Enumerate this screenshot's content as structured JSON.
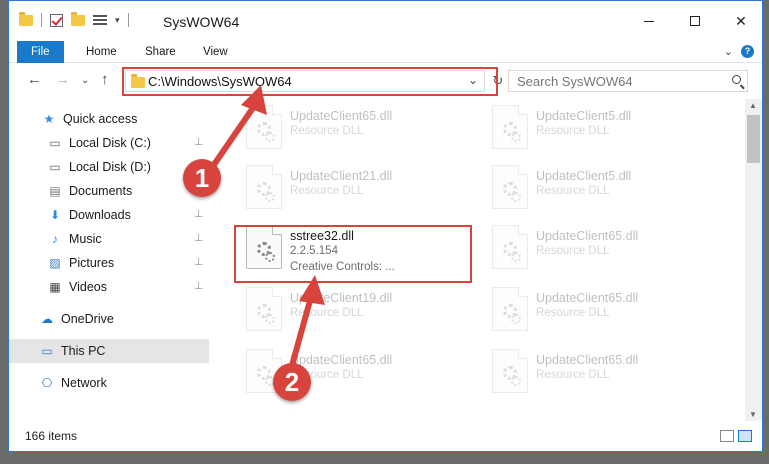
{
  "window": {
    "title": "SysWOW64",
    "controls": {
      "minimize": "—",
      "maximize": "☐",
      "close": "✕"
    }
  },
  "ribbon": {
    "tabs": [
      {
        "label": "File"
      },
      {
        "label": "Home"
      },
      {
        "label": "Share"
      },
      {
        "label": "View"
      }
    ],
    "expand_glyph": "⌄",
    "help_glyph": "?"
  },
  "address": {
    "path": "C:\\Windows\\SysWOW64",
    "refresh_glyph": "↻",
    "caret_glyph": "⌄"
  },
  "search": {
    "placeholder": "Search SysWOW64"
  },
  "nav": {
    "back": "←",
    "forward": "→",
    "recent": "⌄",
    "up": "↑"
  },
  "sidebar": {
    "items": [
      {
        "label": "Quick access",
        "icon": "star-icon",
        "glyph": "★",
        "pinned": false
      },
      {
        "label": "Local Disk (C:)",
        "icon": "drive-icon",
        "glyph": "▭",
        "pinned": true
      },
      {
        "label": "Local Disk (D:)",
        "icon": "drive-icon",
        "glyph": "▭",
        "pinned": false
      },
      {
        "label": "Documents",
        "icon": "documents-icon",
        "glyph": "▤",
        "pinned": false
      },
      {
        "label": "Downloads",
        "icon": "download-icon",
        "glyph": "⬇",
        "pinned": true
      },
      {
        "label": "Music",
        "icon": "music-icon",
        "glyph": "♪",
        "pinned": true
      },
      {
        "label": "Pictures",
        "icon": "pictures-icon",
        "glyph": "▨",
        "pinned": true
      },
      {
        "label": "Videos",
        "icon": "videos-icon",
        "glyph": "▦",
        "pinned": true
      },
      {
        "label": "OneDrive",
        "icon": "cloud-icon",
        "glyph": "☁",
        "pinned": false
      },
      {
        "label": "This PC",
        "icon": "computer-icon",
        "glyph": "▭",
        "pinned": false
      },
      {
        "label": "Network",
        "icon": "network-icon",
        "glyph": "⎔",
        "pinned": false
      }
    ],
    "pin_glyph": "📌"
  },
  "files": [
    {
      "name": "UpdateClient65.dll",
      "type": "Resource DLL",
      "desc": ""
    },
    {
      "name": "UpdateClient5.dll",
      "type": "Resource DLL",
      "desc": ""
    },
    {
      "name": "UpdateClient21.dll",
      "type": "Resource DLL",
      "desc": ""
    },
    {
      "name": "UpdateClient5.dll",
      "type": "Resource DLL",
      "desc": ""
    },
    {
      "name": "sstree32.dll",
      "type": "2.2.5.154",
      "desc": "Creative Controls: ..."
    },
    {
      "name": "UpdateClient65.dll",
      "type": "Resource DLL",
      "desc": ""
    },
    {
      "name": "UpdateClient19.dll",
      "type": "Resource DLL",
      "desc": ""
    },
    {
      "name": "UpdateClient65.dll",
      "type": "Resource DLL",
      "desc": ""
    },
    {
      "name": "UpdateClient65.dll",
      "type": "Resource DLL",
      "desc": ""
    },
    {
      "name": "UpdateClient65.dll",
      "type": "Resource DLL",
      "desc": ""
    }
  ],
  "status": {
    "items": "166 items"
  },
  "annotations": {
    "one": "1",
    "two": "2"
  },
  "colors": {
    "accent": "#1979ca",
    "highlight": "#d9433e"
  }
}
